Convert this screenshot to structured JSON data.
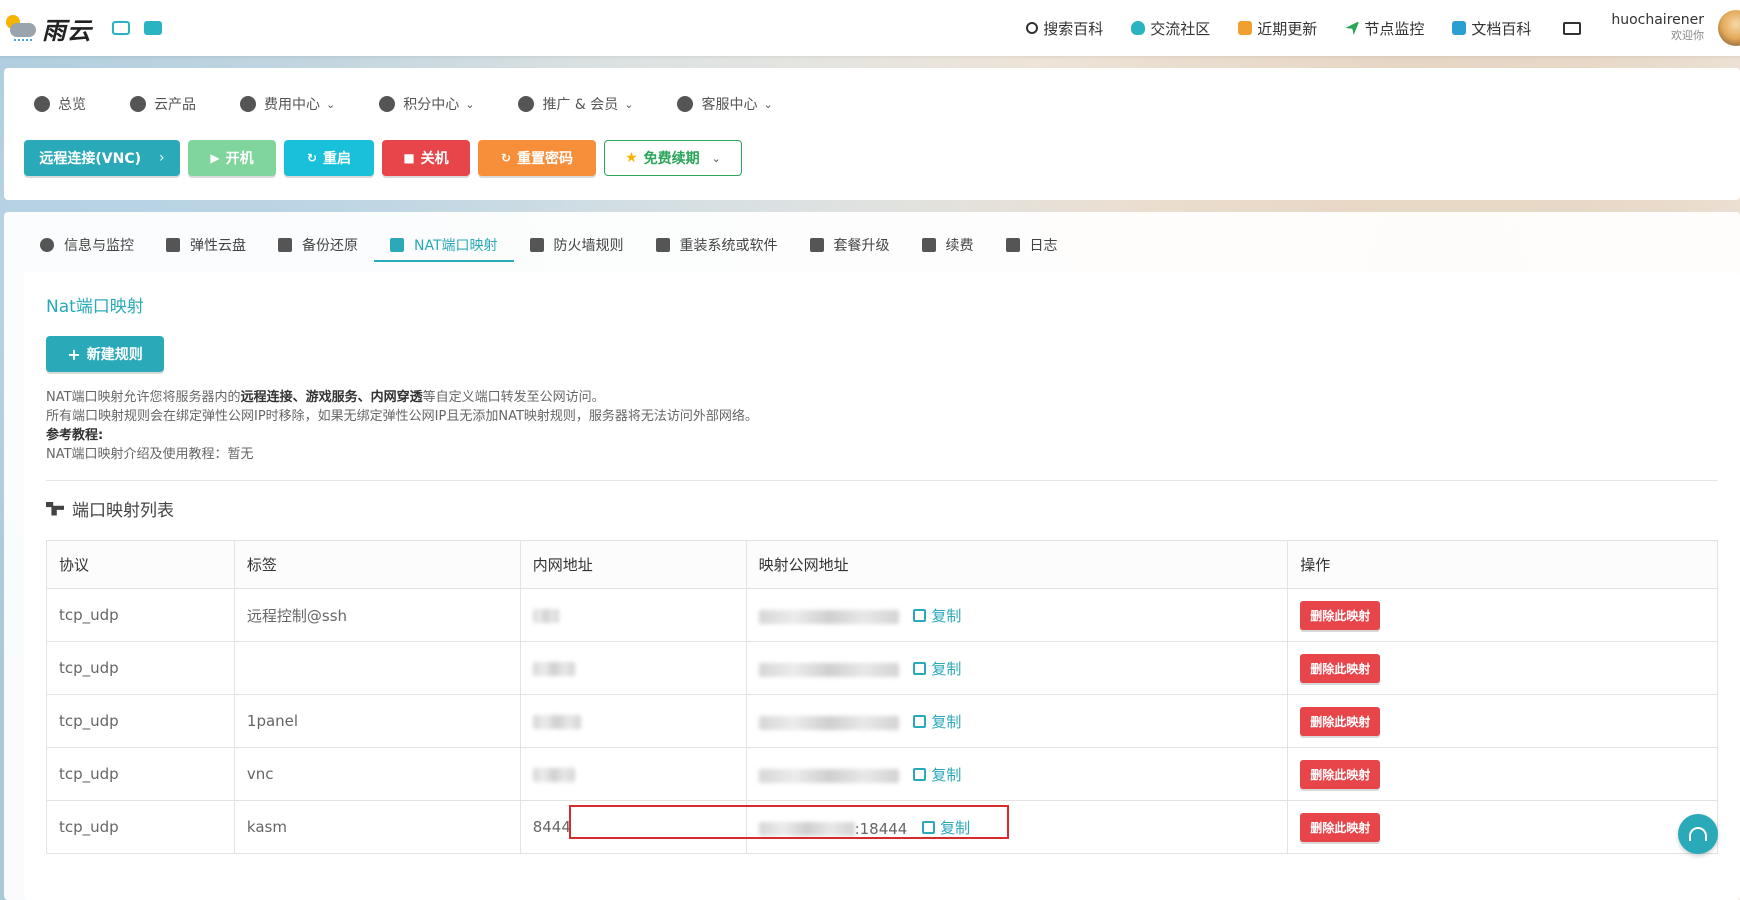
{
  "brand": {
    "logo_text": "雨云"
  },
  "top_nav": {
    "items": [
      {
        "label": "搜索百科",
        "icon": "search-icon"
      },
      {
        "label": "交流社区",
        "icon": "community-icon"
      },
      {
        "label": "近期更新",
        "icon": "news-icon"
      },
      {
        "label": "节点监控",
        "icon": "node-monitor-icon"
      },
      {
        "label": "文档百科",
        "icon": "docs-icon"
      }
    ],
    "user": {
      "name": "huochairener",
      "welcome": "欢迎你"
    }
  },
  "main_menu": [
    {
      "label": "总览",
      "icon": "dashboard-icon",
      "dropdown": false
    },
    {
      "label": "云产品",
      "icon": "cubes-icon",
      "dropdown": false
    },
    {
      "label": "费用中心",
      "icon": "money-icon",
      "dropdown": true
    },
    {
      "label": "积分中心",
      "icon": "gift-icon",
      "dropdown": true
    },
    {
      "label": "推广 & 会员",
      "icon": "users-icon",
      "dropdown": true
    },
    {
      "label": "客服中心",
      "icon": "headset-icon",
      "dropdown": true
    }
  ],
  "actions": {
    "vnc": "远程连接(VNC)",
    "power_on": "开机",
    "restart": "重启",
    "power_off": "关机",
    "reset_password": "重置密码",
    "renew": "免费续期"
  },
  "tabs": [
    {
      "label": "信息与监控",
      "icon": "info-icon"
    },
    {
      "label": "弹性云盘",
      "icon": "disk-icon"
    },
    {
      "label": "备份还原",
      "icon": "server-icon"
    },
    {
      "label": "NAT端口映射",
      "icon": "share-icon",
      "active": true
    },
    {
      "label": "防火墙规则",
      "icon": "align-left-icon"
    },
    {
      "label": "重装系统或软件",
      "icon": "exchange-icon"
    },
    {
      "label": "套餐升级",
      "icon": "double-up-icon"
    },
    {
      "label": "续费",
      "icon": "money-icon"
    },
    {
      "label": "日志",
      "icon": "list-check-icon"
    }
  ],
  "nat": {
    "title": "Nat端口映射",
    "new_rule": "新建规则",
    "desc_line1_a": "NAT端口映射允许您将服务器内的",
    "desc_line1_b": "远程连接、游戏服务、内网穿透",
    "desc_line1_c": "等自定义端口转发至公网访问。",
    "desc_line2": "所有端口映射规则会在绑定弹性公网IP时移除，如果无绑定弹性公网IP且无添加NAT映射规则，服务器将无法访问外部网络。",
    "desc_line3": "参考教程:",
    "desc_line4": "NAT端口映射介绍及使用教程：暂无",
    "list_title": "端口映射列表",
    "columns": [
      "协议",
      "标签",
      "内网地址",
      "映射公网地址",
      "操作"
    ],
    "copy_label": "复制",
    "delete_label": "删除此映射",
    "rows": [
      {
        "protocol": "tcp_udp",
        "tag": "远程控制@ssh",
        "internal": "",
        "public": ""
      },
      {
        "protocol": "tcp_udp",
        "tag": "",
        "internal": "",
        "public": ""
      },
      {
        "protocol": "tcp_udp",
        "tag": "1panel",
        "internal": "",
        "public": ""
      },
      {
        "protocol": "tcp_udp",
        "tag": "vnc",
        "internal": "",
        "public": ""
      },
      {
        "protocol": "tcp_udp",
        "tag": "kasm",
        "internal": "8444",
        "public": ":18444"
      }
    ]
  },
  "colors": {
    "accent": "#2aa9b8",
    "danger": "#e8454b",
    "warning": "#f68e3a",
    "success": "#2aa55a"
  }
}
